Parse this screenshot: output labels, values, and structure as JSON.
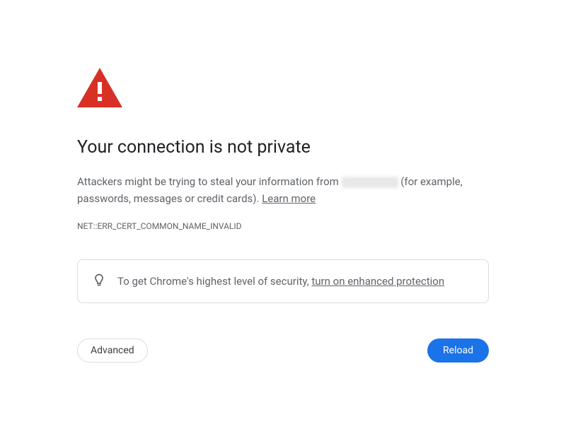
{
  "title": "Your connection is not private",
  "description": {
    "prefix": "Attackers might be trying to steal your information from ",
    "suffix": " (for example, passwords, messages or credit cards). ",
    "learn_more": "Learn more"
  },
  "error_code": "NET::ERR_CERT_COMMON_NAME_INVALID",
  "info_box": {
    "prefix": "To get Chrome's highest level of security, ",
    "link": "turn on enhanced protection"
  },
  "buttons": {
    "advanced": "Advanced",
    "reload": "Reload"
  }
}
